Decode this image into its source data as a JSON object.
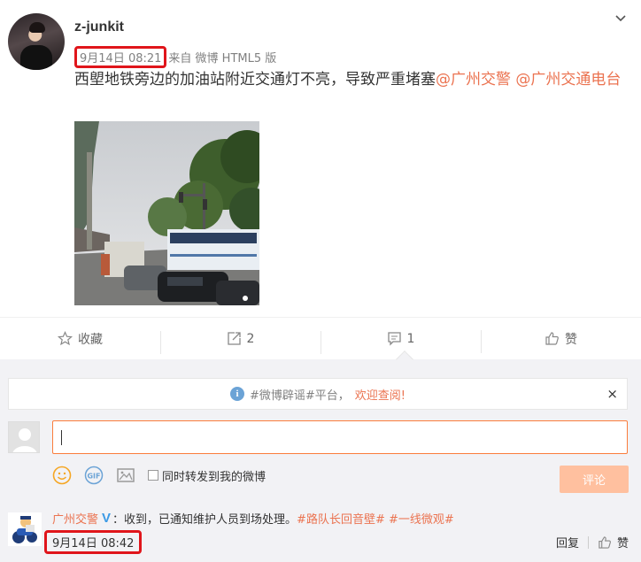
{
  "post": {
    "username": "z-junkit",
    "time": "9月14日 08:21",
    "source": "来自 微博 HTML5 版",
    "text_main": "西塱地铁旁边的加油站附近交通灯不亮，导致严重堵塞",
    "mention_1": "@广州交警",
    "mention_2": "@广州交通电台",
    "chevron_icon": "chevron-down-icon"
  },
  "actions": {
    "favorite_label": "收藏",
    "share_count": "2",
    "comment_count": "1",
    "like_label": "赞"
  },
  "comments": {
    "notice_part1": "#微博辟谣#平台，",
    "notice_part2": "欢迎查阅!",
    "notice_close": "×",
    "forward_label": "同时转发到我的微博",
    "submit_label": "评论",
    "input_value": ""
  },
  "reply": {
    "user": "广州交警",
    "badge": "V",
    "text": "：收到，已通知维护人员到场处理。",
    "tag1": "#路队长回音壁#",
    "tag2": "#一线微观#",
    "time": "9月14日 08:42",
    "reply_label": "回复",
    "like_label": "赞"
  },
  "colors": {
    "accent": "#eb7350",
    "highlight_box": "#e0151b",
    "submit_disabled": "#ffc09f",
    "verified": "#3b9ae5"
  }
}
